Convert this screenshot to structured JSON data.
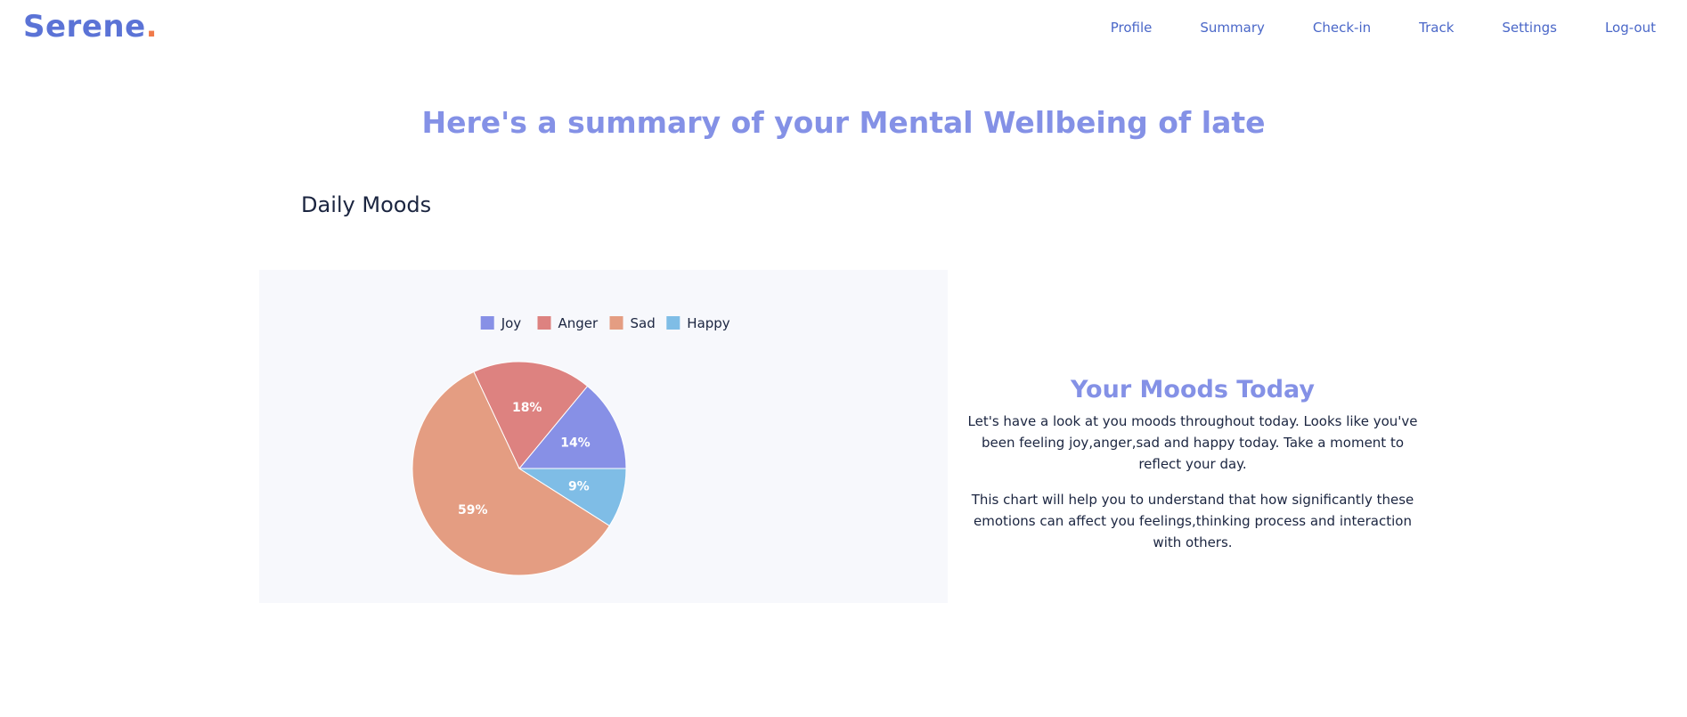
{
  "header": {
    "brand_name": "Serene",
    "brand_dot": ".",
    "nav_links": [
      "Profile",
      "Summary",
      "Check-in",
      "Track",
      "Settings",
      "Log-out"
    ]
  },
  "page_title": "Here's a summary of your Mental Wellbeing of late",
  "section_title": "Daily Moods",
  "info": {
    "title": "Your Moods Today",
    "paragraph1": "Let's have a look at you moods throughout today. Looks like you've been feeling joy,anger,sad and happy today. Take a moment to reflect your day.",
    "paragraph2": "This chart will help you to understand that how significantly these emotions can affect you feelings,thinking process and interaction with others."
  },
  "colors": {
    "brand": "#5b73d6",
    "brand_dot": "#f07a4a",
    "nav": "#4a67c8",
    "title": "#8491e6",
    "panel_bg": "#f7f8fc"
  },
  "chart_data": {
    "type": "pie",
    "title": "",
    "legend_position": "top",
    "slices": [
      {
        "label": "Joy",
        "value": 14,
        "display": "14%",
        "color": "#8790e6"
      },
      {
        "label": "Anger",
        "value": 18,
        "display": "18%",
        "color": "#dd8280"
      },
      {
        "label": "Sad",
        "value": 59,
        "display": "59%",
        "color": "#e49d82"
      },
      {
        "label": "Happy",
        "value": 9,
        "display": "9%",
        "color": "#7fbde6"
      }
    ]
  }
}
